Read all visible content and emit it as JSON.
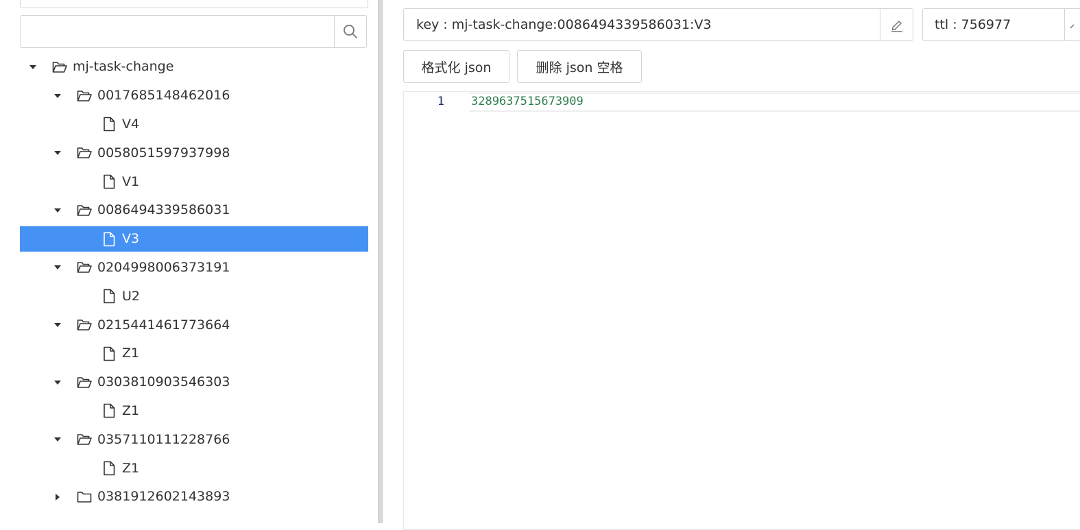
{
  "search": {
    "placeholder": ""
  },
  "tree": {
    "root": {
      "label": "mj-task-change",
      "expanded": true
    },
    "rows": [
      {
        "type": "folder",
        "label": "0017685148462016",
        "expanded": true,
        "level": 1
      },
      {
        "type": "file",
        "label": "V4",
        "level": 2
      },
      {
        "type": "folder",
        "label": "0058051597937998",
        "expanded": true,
        "level": 1
      },
      {
        "type": "file",
        "label": "V1",
        "level": 2
      },
      {
        "type": "folder",
        "label": "0086494339586031",
        "expanded": true,
        "level": 1
      },
      {
        "type": "file",
        "label": "V3",
        "level": 2,
        "selected": true
      },
      {
        "type": "folder",
        "label": "0204998006373191",
        "expanded": true,
        "level": 1
      },
      {
        "type": "file",
        "label": "U2",
        "level": 2
      },
      {
        "type": "folder",
        "label": "0215441461773664",
        "expanded": true,
        "level": 1
      },
      {
        "type": "file",
        "label": "Z1",
        "level": 2
      },
      {
        "type": "folder",
        "label": "0303810903546303",
        "expanded": true,
        "level": 1
      },
      {
        "type": "file",
        "label": "Z1",
        "level": 2
      },
      {
        "type": "folder",
        "label": "0357110111228766",
        "expanded": true,
        "level": 1
      },
      {
        "type": "file",
        "label": "Z1",
        "level": 2
      },
      {
        "type": "folder",
        "label": "0381912602143893",
        "expanded": false,
        "level": 1
      }
    ]
  },
  "detail": {
    "key_text": "key : mj-task-change:0086494339586031:V3",
    "ttl_text": "ttl : 756977",
    "format_json_label": "格式化 json",
    "strip_json_label": "删除 json 空格",
    "editor": {
      "line_number": "1",
      "line_content": "3289637515673909"
    }
  },
  "colors": {
    "selection": "#4591f4",
    "line_number": "#1f2f6b",
    "code_text": "#2f7d4d"
  }
}
